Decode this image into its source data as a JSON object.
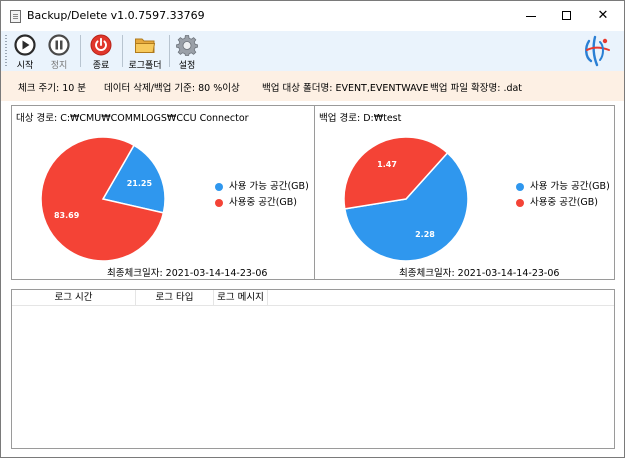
{
  "window": {
    "title": "Backup/Delete v1.0.7597.33769",
    "controls": {
      "minimize": "minimize",
      "maximize": "maximize",
      "close": "✕"
    }
  },
  "toolbar": {
    "start_label": "시작",
    "stop_label": "정지",
    "exit_label": "종료",
    "log_folder_label": "로그폴더",
    "settings_label": "설정"
  },
  "info": {
    "check_cycle": "체크 주기: 10 분",
    "delete_rule": "데이터 삭제/백업 기준: 80 %이상",
    "backup_folders": "백업 대상 폴더명: EVENT,EVENTWAVE",
    "backup_ext": "백업 파일 확장명: .dat"
  },
  "source_panel": {
    "path": "대상 경로: C:₩CMU₩COMMLOGS₩CCU Connector",
    "last_check": "최종체크일자: 2021-03-14-14-23-06"
  },
  "backup_panel": {
    "path": "백업 경로: D:₩test",
    "last_check": "최종체크일자: 2021-03-14-14-23-06"
  },
  "chart_data": [
    {
      "type": "pie",
      "series": [
        {
          "name": "사용 가능 공간(GB)",
          "value": 21.25,
          "label": "21.25",
          "color": "#2f97ee"
        },
        {
          "name": "사용중 공간(GB)",
          "value": 83.69,
          "label": "83.69",
          "color": "#f44336"
        }
      ]
    },
    {
      "type": "pie",
      "series": [
        {
          "name": "사용 가능 공간(GB)",
          "value": 2.28,
          "label": "2.28",
          "color": "#2f97ee"
        },
        {
          "name": "사용중 공간(GB)",
          "value": 1.47,
          "label": "1.47",
          "color": "#f44336"
        }
      ]
    }
  ],
  "log": {
    "columns": [
      "로그 시간",
      "로그 타입",
      "로그 메시지"
    ]
  },
  "colors": {
    "toolbar_bg": "#eaf3fc",
    "info_bg": "#fdf0e4",
    "free_space": "#2f97ee",
    "used_space": "#f44336"
  }
}
